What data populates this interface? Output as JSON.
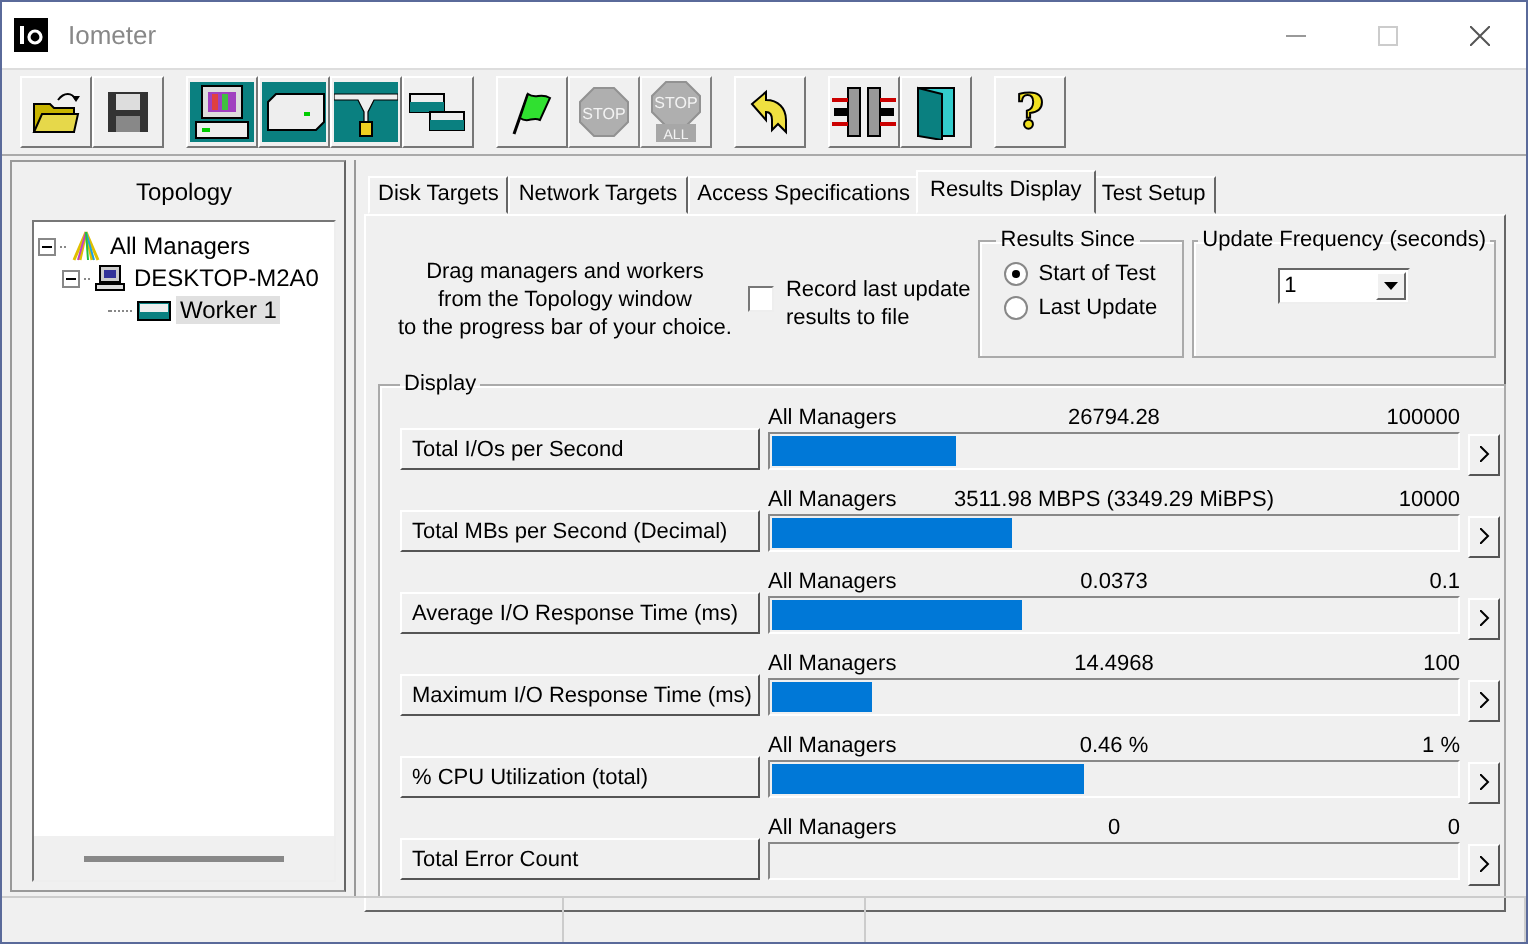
{
  "window": {
    "title": "Iometer"
  },
  "toolbar": [
    {
      "kind": "open",
      "disabled": false
    },
    {
      "kind": "save",
      "disabled": false
    },
    {
      "kind": "manager",
      "disabled": false
    },
    {
      "kind": "disk-worker",
      "disabled": false
    },
    {
      "kind": "network-worker",
      "disabled": false
    },
    {
      "kind": "copy-worker",
      "disabled": false
    },
    {
      "kind": "start",
      "disabled": false
    },
    {
      "kind": "stop",
      "label": "STOP",
      "disabled": true
    },
    {
      "kind": "stop-all",
      "label": "STOP",
      "sublabel": "ALL",
      "disabled": true
    },
    {
      "kind": "reset",
      "disabled": false
    },
    {
      "kind": "disconnect",
      "disabled": false
    },
    {
      "kind": "exit",
      "disabled": false
    },
    {
      "kind": "help",
      "label": "?",
      "disabled": false
    }
  ],
  "topology": {
    "title": "Topology",
    "tree": [
      {
        "kind": "all",
        "label": "All Managers",
        "expanded": true,
        "selected": false,
        "children": [
          {
            "kind": "manager",
            "label": "DESKTOP-M2A0",
            "expanded": true,
            "selected": false,
            "children": [
              {
                "kind": "worker",
                "label": "Worker 1",
                "selected": true
              }
            ]
          }
        ]
      }
    ]
  },
  "tabs": [
    {
      "label": "Disk Targets",
      "selected": false
    },
    {
      "label": "Network Targets",
      "selected": false
    },
    {
      "label": "Access Specifications",
      "selected": false
    },
    {
      "label": "Results Display",
      "selected": true
    },
    {
      "label": "Test Setup",
      "selected": false
    }
  ],
  "instructions": "Drag managers and workers\nfrom the Topology window\nto the progress bar of your choice.",
  "record": {
    "label": "Record last update\nresults to file",
    "checked": false
  },
  "results_since": {
    "title": "Results Since",
    "options": [
      {
        "label": "Start of Test",
        "selected": true
      },
      {
        "label": "Last Update",
        "selected": false
      }
    ]
  },
  "update_frequency": {
    "title": "Update Frequency (seconds)",
    "value": "1"
  },
  "display": {
    "title": "Display",
    "rows": [
      {
        "label": "Total I/Os per Second",
        "source": "All Managers",
        "value": "26794.28",
        "max": "100000",
        "level": 0.268
      },
      {
        "label": "Total MBs per Second (Decimal)",
        "source": "All Managers",
        "value": "3511.98 MBPS (3349.29 MiBPS)",
        "max": "10000",
        "level": 0.351
      },
      {
        "label": "Average I/O Response Time (ms)",
        "source": "All Managers",
        "value": "0.0373",
        "max": "0.1",
        "level": 0.365
      },
      {
        "label": "Maximum I/O Response Time (ms)",
        "source": "All Managers",
        "value": "14.4968",
        "max": "100",
        "level": 0.145
      },
      {
        "label": "% CPU Utilization (total)",
        "source": "All Managers",
        "value": "0.46 %",
        "max": "1 %",
        "level": 0.455
      },
      {
        "label": "Total Error Count",
        "source": "All Managers",
        "value": "0",
        "max": "0",
        "level": 0
      }
    ]
  }
}
